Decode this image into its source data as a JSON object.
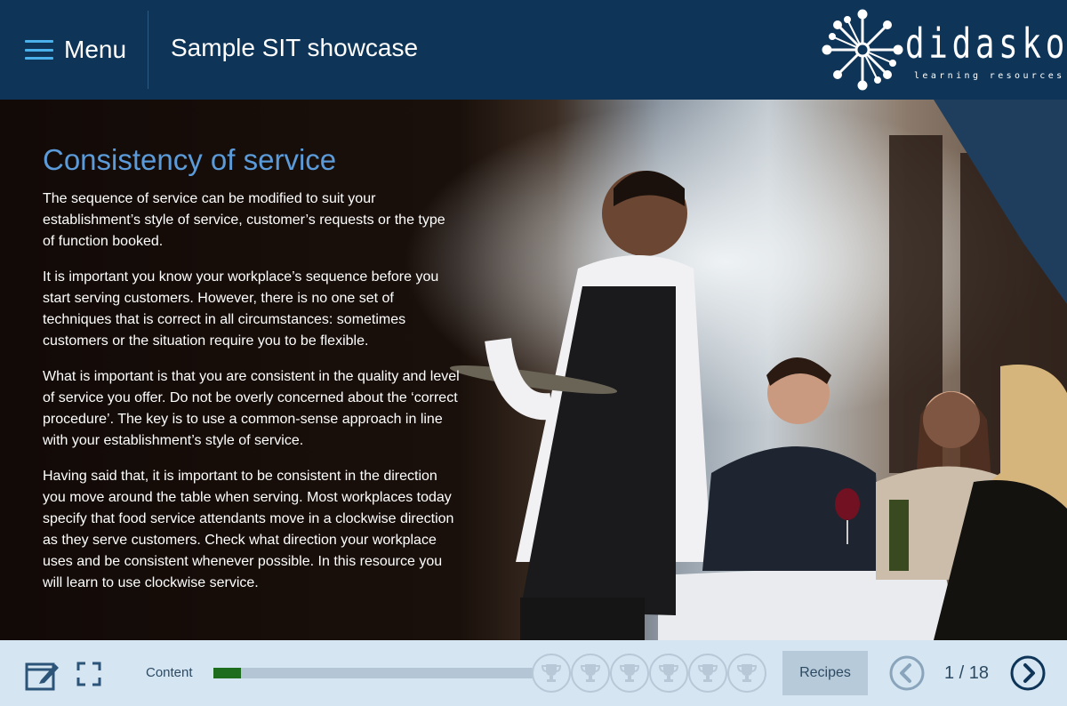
{
  "header": {
    "menu_label": "Menu",
    "course_title": "Sample SIT showcase",
    "logo_text": "didasko",
    "logo_tagline": "learning resources",
    "menu_icon": "hamburger-icon",
    "logo_icon": "didasko-sunburst-logo"
  },
  "slide": {
    "title": "Consistency of service",
    "paragraphs": [
      "The sequence of service can be modified to suit your establishment’s style of service, customer’s requests or the type of function booked.",
      "It is important you know your workplace’s sequence before you start serving customers. However, there is no one set of techniques that is correct in all circumstances: sometimes customers or the situation require you to be flexible.",
      "What is important is that you are consistent in the quality and level of service you offer. Do not be overly concerned about the ‘correct procedure’. The key is to use a common-sense approach in line with your establishment’s style of service.",
      "Having said that, it is important to be consistent in the direction you move around the table when serving. Most workplaces today specify that food service attendants move in a clockwise direction as they serve customers. Check what direction your workplace uses and be consistent whenever possible. In this resource you will learn to use clockwise service."
    ],
    "image_subject": "waiter serving plated meal to diners at outdoor restaurant"
  },
  "footer": {
    "progress_label": "Content",
    "progress_fraction": 0.08,
    "trophy_count": 6,
    "recipes_label": "Recipes",
    "page_current": 1,
    "page_total": 18,
    "page_text": "1 / 18",
    "icons": [
      "notes-icon",
      "fullscreen-icon",
      "trophy-icon",
      "chevron-left-icon",
      "chevron-right-icon"
    ],
    "colors": {
      "accent": "#4bb1ea",
      "progress": "#1e6d1e",
      "nav": "#0e3558",
      "title": "#5b9bd9"
    }
  }
}
